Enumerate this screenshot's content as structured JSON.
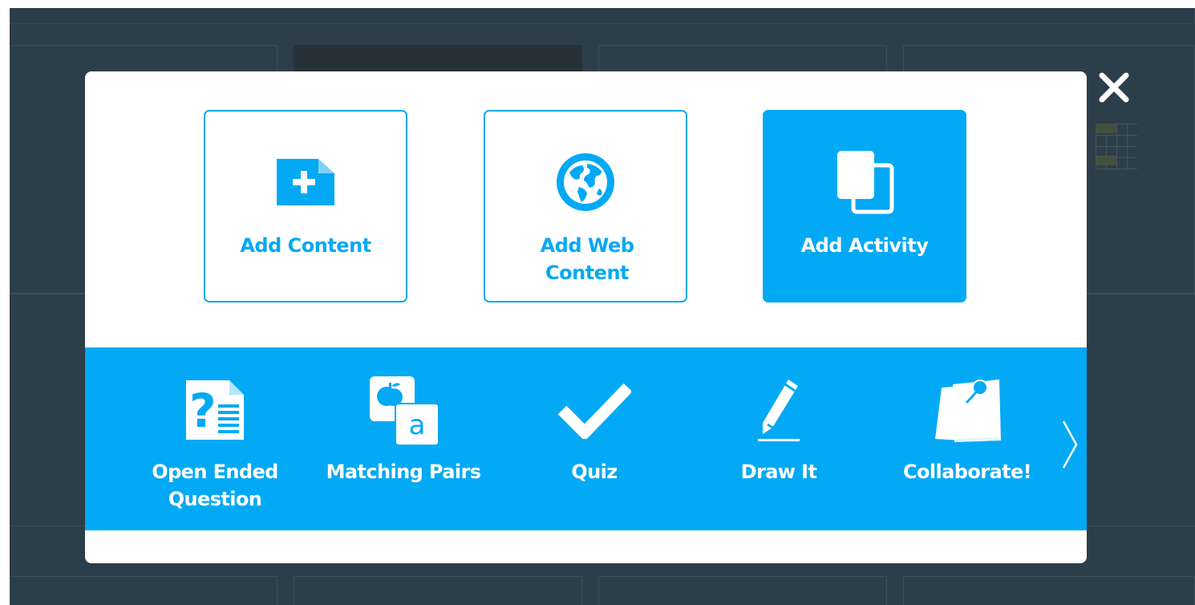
{
  "colors": {
    "accent": "#03a9f4",
    "overlay": "#2c3e4a",
    "modal_bg": "#ffffff"
  },
  "close": {
    "icon": "close-icon"
  },
  "options": [
    {
      "label": "Add Content",
      "icon": "add-file-icon",
      "selected": false
    },
    {
      "label": "Add Web Content",
      "icon": "globe-icon",
      "selected": false
    },
    {
      "label": "Add Activity",
      "icon": "copy-pages-icon",
      "selected": true
    }
  ],
  "activities": [
    {
      "label": "Open Ended Question",
      "icon": "question-document-icon"
    },
    {
      "label": "Matching Pairs",
      "icon": "matching-cards-icon",
      "icon_letter": "a"
    },
    {
      "label": "Quiz",
      "icon": "checkmark-icon"
    },
    {
      "label": "Draw It",
      "icon": "pencil-icon"
    },
    {
      "label": "Collaborate!",
      "icon": "pinned-note-icon"
    }
  ],
  "next": {
    "icon": "chevron-right-icon"
  }
}
